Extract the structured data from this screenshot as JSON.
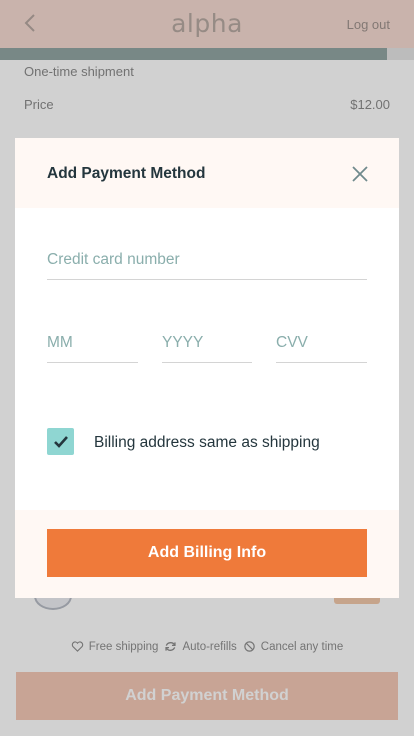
{
  "header": {
    "brand": "alpha",
    "logout_label": "Log out",
    "back_icon": "chevron-left-icon",
    "progress_fraction": 0.935
  },
  "order": {
    "shipment_label": "One-time shipment",
    "price_label": "Price",
    "price_value": "$12.00"
  },
  "features": [
    {
      "icon": "heart-icon",
      "label": "Free shipping"
    },
    {
      "icon": "refresh-icon",
      "label": "Auto-refills"
    },
    {
      "icon": "cancel-icon",
      "label": "Cancel any time"
    }
  ],
  "cta_label": "Add Payment Method",
  "modal": {
    "title": "Add Payment Method",
    "card_placeholder": "Credit card number",
    "month_placeholder": "MM",
    "year_placeholder": "YYYY",
    "cvv_placeholder": "CVV",
    "billing_same_label": "Billing address same as shipping",
    "billing_same_checked": true,
    "submit_label": "Add Billing Info"
  },
  "colors": {
    "accent": "#ef7a3a",
    "checkbox": "#8fd6d2",
    "heading": "#24363d",
    "placeholder": "#8aaeac"
  }
}
